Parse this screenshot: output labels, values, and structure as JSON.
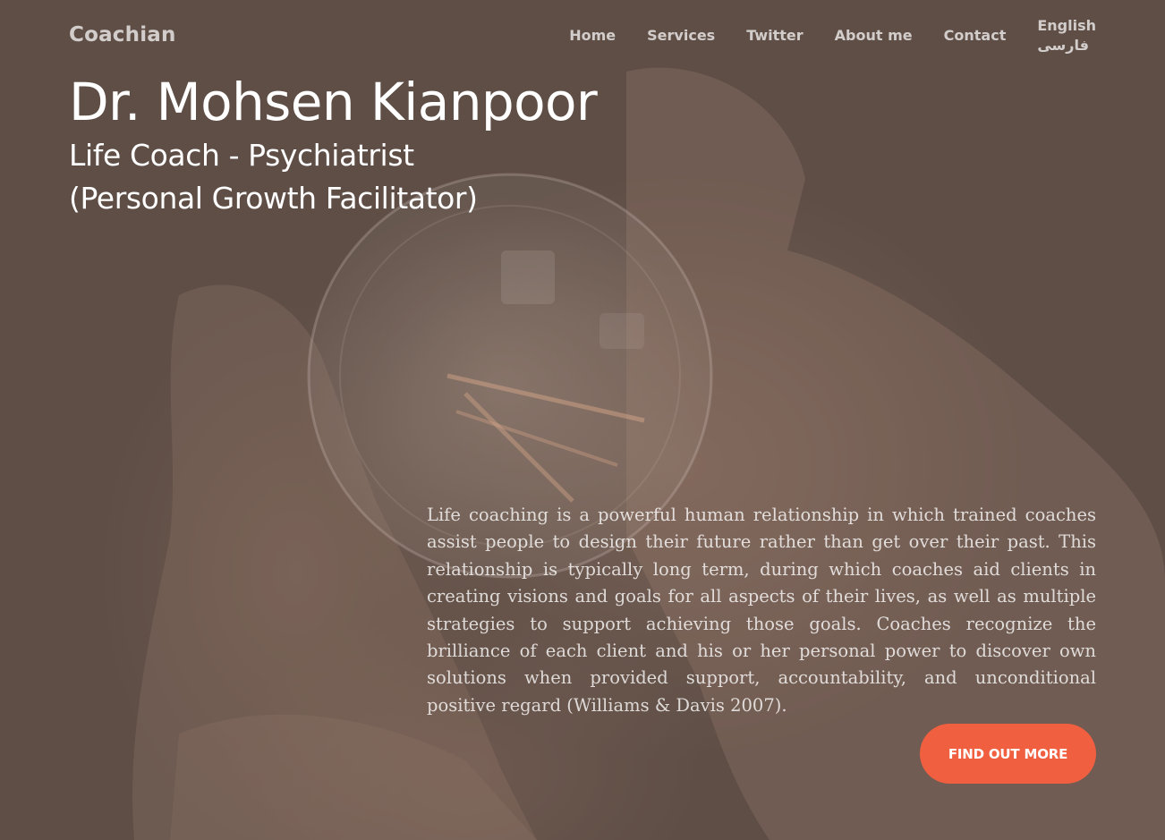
{
  "brand": "Coachian",
  "nav": {
    "items": [
      {
        "label": "Home"
      },
      {
        "label": "Services"
      },
      {
        "label": "Twitter"
      },
      {
        "label": "About me"
      },
      {
        "label": "Contact"
      }
    ],
    "languages": [
      "English",
      "فارسی"
    ]
  },
  "hero": {
    "name": "Dr. Mohsen Kianpoor",
    "subtitle_line1": "Life Coach - Psychiatrist",
    "subtitle_line2": "(Personal Growth Facilitator)",
    "intro": "Life coaching is a powerful human relationship in which trained coaches assist people to design their future rather than get over their past. This relationship is typically long term, during which coaches aid clients in creating visions and goals for all aspects of their lives, as well as multiple strategies to support achieving those goals. Coaches recognize the brilliance of each client and his or her personal power to discover own solutions when provided support, accountability, and unconditional positive regard (Williams & Davis 2007).",
    "cta_label": "Find Out More"
  },
  "colors": {
    "overlay": "#5e4e46",
    "accent": "#f05f40"
  },
  "background_image": "hands-holding-light-bulb"
}
